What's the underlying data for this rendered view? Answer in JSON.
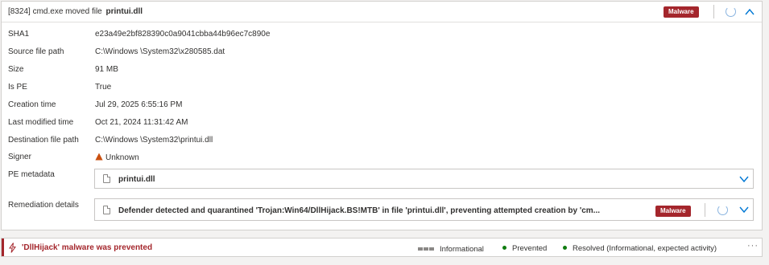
{
  "header": {
    "prefix": "[8324] cmd.exe moved file",
    "filename": "printui.dll",
    "badge": "Malware"
  },
  "details": [
    {
      "label": "SHA1",
      "value": "e23a49e2bf828390c0a9041cbba44b96ec7c890e"
    },
    {
      "label": "Source file path",
      "value": "C:\\Windows \\System32\\x280585.dat"
    },
    {
      "label": "Size",
      "value": "91 MB"
    },
    {
      "label": "Is PE",
      "value": "True"
    },
    {
      "label": "Creation time",
      "value": "Jul 29, 2025 6:55:16 PM"
    },
    {
      "label": "Last modified time",
      "value": "Oct 21, 2024 11:31:42 AM"
    },
    {
      "label": "Destination file path",
      "value": "C:\\Windows \\System32\\printui.dll"
    },
    {
      "label": "Signer",
      "value": "Unknown"
    }
  ],
  "pe_metadata": {
    "label": "PE metadata",
    "value": "printui.dll"
  },
  "remediation": {
    "label": "Remediation details",
    "text": "Defender detected and quarantined 'Trojan:Win64/DllHijack.BS!MTB' in file 'printui.dll', preventing attempted creation by 'cm...",
    "badge": "Malware"
  },
  "footer": {
    "title": "'DllHijack' malware was prevented",
    "severity": "Informational",
    "status1": "Prevented",
    "status2": "Resolved (Informational, expected activity)",
    "more": "···"
  },
  "colors": {
    "malware_badge": "#a4262c",
    "status_dot": "#107c10",
    "warning": "#ca5010",
    "accent": "#0078d4"
  }
}
